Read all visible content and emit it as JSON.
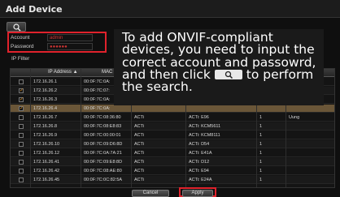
{
  "window": {
    "title": "Add Device"
  },
  "credentials": {
    "account_label": "Account",
    "account_value": "admin",
    "password_label": "Password",
    "password_value": "●●●●●●",
    "ip_filter_label": "IP Filter"
  },
  "table": {
    "headers": [
      "IP Address ▲",
      "MAC"
    ],
    "rows": [
      {
        "checked": false,
        "ip": "172.16.26.1",
        "mac": "00:0F:7C:0A:",
        "vendor": "",
        "model": "",
        "ch": "",
        "extra": "",
        "sel": false
      },
      {
        "checked": true,
        "ip": "172.16.26.2",
        "mac": "00:0F:7C:07:",
        "vendor": "",
        "model": "",
        "ch": "",
        "extra": "",
        "sel": false
      },
      {
        "checked": true,
        "ip": "172.16.26.3",
        "mac": "00:0F:7C:0A:",
        "vendor": "",
        "model": "",
        "ch": "",
        "extra": "",
        "sel": false
      },
      {
        "checked": true,
        "ip": "172.16.26.4",
        "mac": "00:0F:7C:0A:",
        "vendor": "",
        "model": "",
        "ch": "",
        "extra": "",
        "sel": true
      },
      {
        "checked": false,
        "ip": "172.16.26.7",
        "mac": "00:0F:7C:08:36:80",
        "vendor": "ACTi",
        "model": "ACTi: E96",
        "ch": "1",
        "extra": "Uung",
        "sel": false
      },
      {
        "checked": false,
        "ip": "172.16.26.8",
        "mac": "00:0F:7C:08:E8:83",
        "vendor": "ACTi",
        "model": "ACTi: KCM5611",
        "ch": "1",
        "extra": "",
        "sel": false
      },
      {
        "checked": false,
        "ip": "172.16.26.9",
        "mac": "00:0F:7C:00:00:01",
        "vendor": "ACTi",
        "model": "ACTi: KCM8111",
        "ch": "1",
        "extra": "",
        "sel": false
      },
      {
        "checked": false,
        "ip": "172.16.26.10",
        "mac": "00:0F:7C:09:D6:8D",
        "vendor": "ACTi",
        "model": "ACTi: D54",
        "ch": "1",
        "extra": "",
        "sel": false
      },
      {
        "checked": false,
        "ip": "172.16.26.12",
        "mac": "00:0F:7C:0A:7A:21",
        "vendor": "ACTi",
        "model": "ACTi: E41A",
        "ch": "1",
        "extra": "",
        "sel": false
      },
      {
        "checked": false,
        "ip": "172.16.26.41",
        "mac": "00:0F:7C:09:E8:8D",
        "vendor": "ACTi",
        "model": "ACTi: D12",
        "ch": "1",
        "extra": "",
        "sel": false
      },
      {
        "checked": false,
        "ip": "172.16.26.42",
        "mac": "00:0F:7C:08:AE:80",
        "vendor": "ACTi",
        "model": "ACTi: E94",
        "ch": "1",
        "extra": "",
        "sel": false
      },
      {
        "checked": false,
        "ip": "172.16.26.45",
        "mac": "00:0F:7C:0C:82:5A",
        "vendor": "ACTi",
        "model": "ACTi: E24A",
        "ch": "1",
        "extra": "",
        "sel": false
      }
    ]
  },
  "callout": {
    "text_before": "To add ONVIF-compliant devices, you need to input the correct account and passowrd, and then click",
    "text_after": "to perform the search."
  },
  "footer": {
    "cancel_label": "Cancel",
    "apply_label": "Apply"
  },
  "colors": {
    "highlight_red": "#e0222c",
    "selected_row": "#6a5638",
    "check_orange": "#e0952a"
  },
  "icons": [
    "search-icon",
    "magnifier-icon"
  ]
}
